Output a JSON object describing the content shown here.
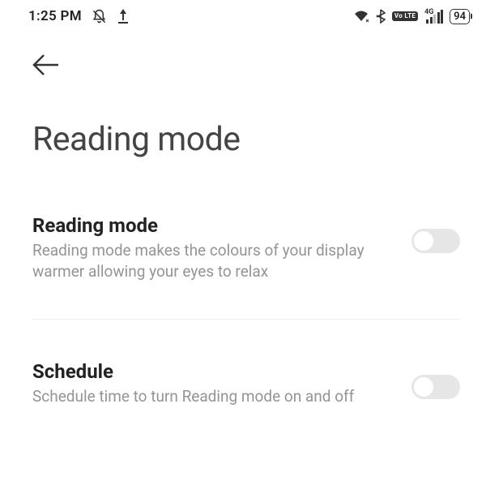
{
  "status": {
    "time": "1:25 PM",
    "volte": "Vo LTE",
    "network_type": "4G",
    "battery": "94"
  },
  "page": {
    "title": "Reading mode"
  },
  "settings": [
    {
      "title": "Reading mode",
      "desc": "Reading mode makes the colours of your display warmer allowing your eyes to relax",
      "on": false
    },
    {
      "title": "Schedule",
      "desc": "Schedule time to turn Reading mode on and off",
      "on": false
    }
  ]
}
